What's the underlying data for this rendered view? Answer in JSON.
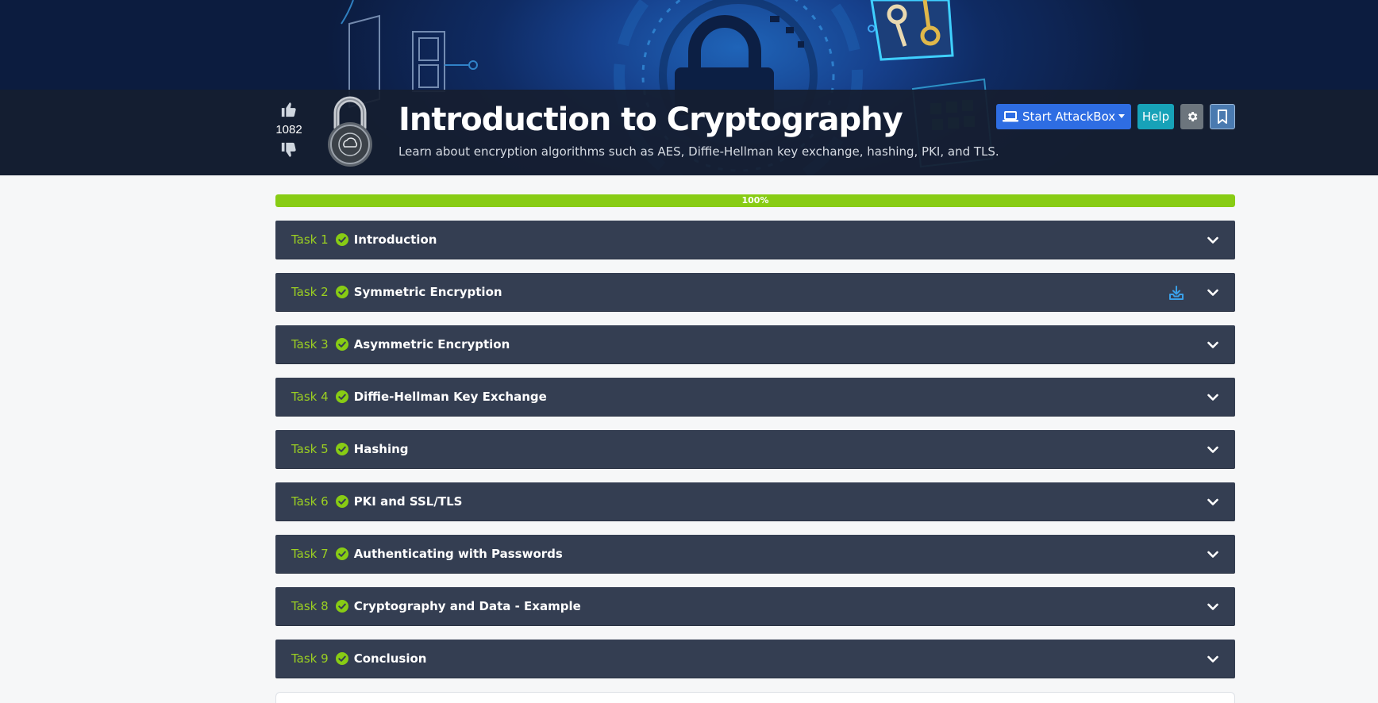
{
  "room": {
    "title": "Introduction to Cryptography",
    "description": "Learn about encryption algorithms such as AES, Diffie-Hellman key exchange, hashing, PKI, and TLS.",
    "votes": "1082",
    "icon": "padlock-icon"
  },
  "toolbar": {
    "attackbox_label": "Start AttackBox",
    "help_label": "Help",
    "settings_icon": "gear-icon",
    "bookmark_icon": "bookmark-icon"
  },
  "progress": {
    "value": 1.0,
    "label": "100%"
  },
  "tasks": [
    {
      "number": "Task 1",
      "title": "Introduction",
      "completed": true,
      "download": false
    },
    {
      "number": "Task 2",
      "title": "Symmetric Encryption",
      "completed": true,
      "download": true
    },
    {
      "number": "Task 3",
      "title": "Asymmetric Encryption",
      "completed": true,
      "download": false
    },
    {
      "number": "Task 4",
      "title": "Diffie-Hellman Key Exchange",
      "completed": true,
      "download": false
    },
    {
      "number": "Task 5",
      "title": "Hashing",
      "completed": true,
      "download": false
    },
    {
      "number": "Task 6",
      "title": "PKI and SSL/TLS",
      "completed": true,
      "download": false
    },
    {
      "number": "Task 7",
      "title": "Authenticating with Passwords",
      "completed": true,
      "download": false
    },
    {
      "number": "Task 8",
      "title": "Cryptography and Data - Example",
      "completed": true,
      "download": false
    },
    {
      "number": "Task 9",
      "title": "Conclusion",
      "completed": true,
      "download": false
    }
  ],
  "colors": {
    "task_bg": "#343e52",
    "task_accent": "#9bcf22",
    "progress_fill": "#88cc14",
    "attackbox_button": "#2e6de3",
    "help_button": "#17a2b8"
  }
}
